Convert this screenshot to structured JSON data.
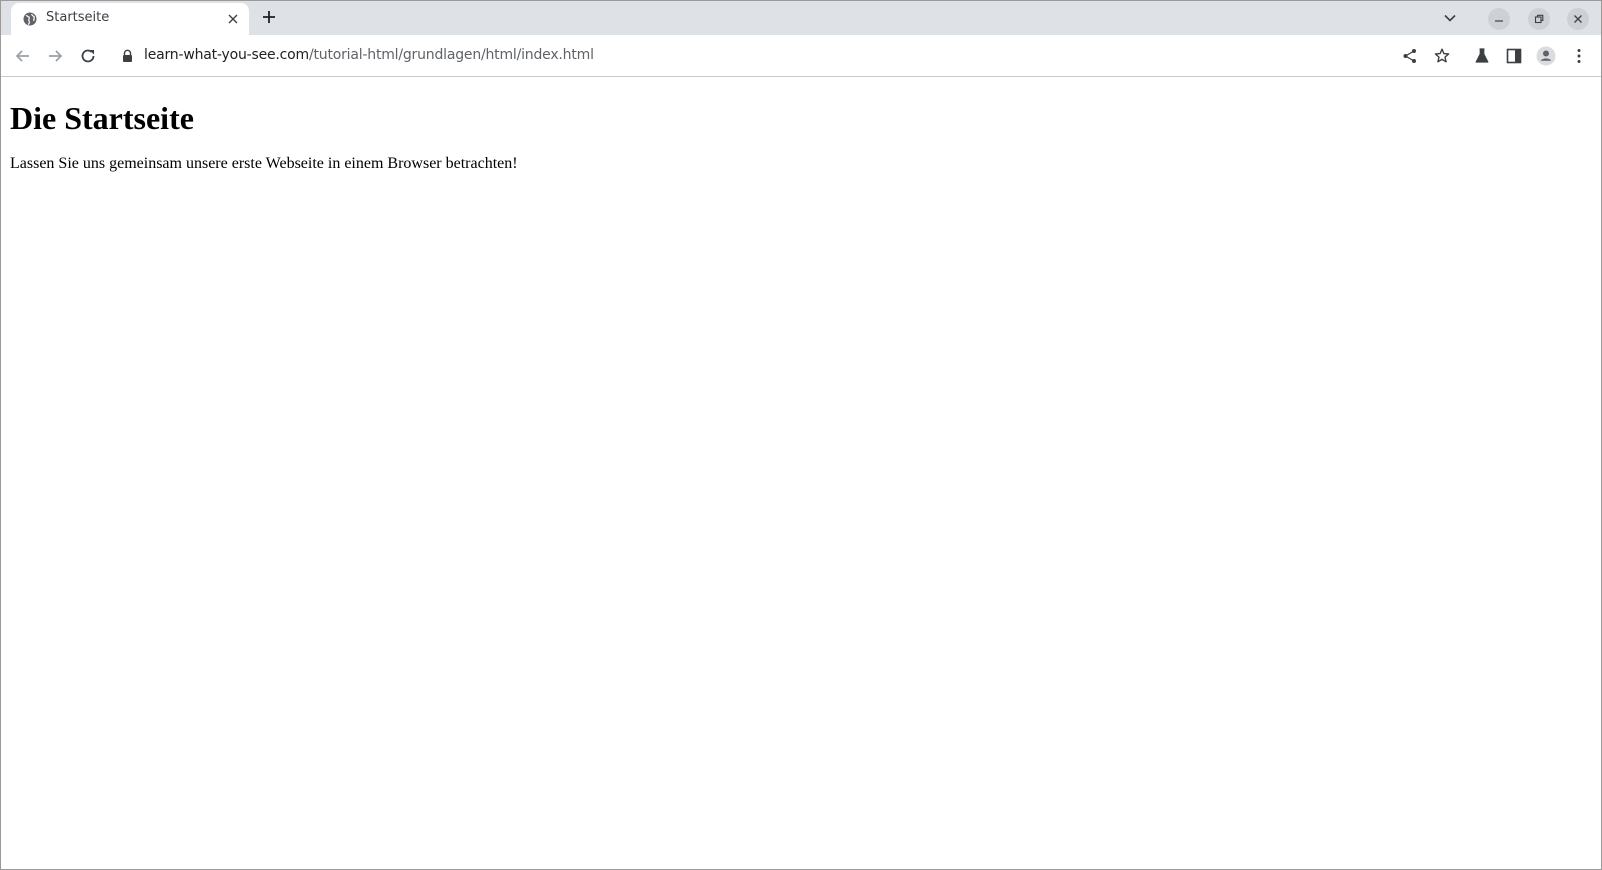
{
  "browser": {
    "tab": {
      "title": "Startseite",
      "favicon": "globe-icon"
    },
    "address_bar": {
      "host": "learn-what-you-see.com",
      "path": "/tutorial-html/grundlagen/html/index.html"
    },
    "icons": {
      "close_tab": "close-icon",
      "new_tab": "plus-icon",
      "tab_search": "chevron-down-icon",
      "minimize": "minimize-icon",
      "restore": "restore-icon",
      "close_window": "close-icon",
      "back": "arrow-left-icon",
      "forward": "arrow-right-icon",
      "reload": "reload-icon",
      "lock": "lock-icon",
      "share": "share-icon",
      "bookmark": "star-icon",
      "labs": "flask-icon",
      "side_panel": "side-panel-icon",
      "profile": "profile-icon",
      "menu": "kebab-menu-icon"
    },
    "colors": {
      "tabstrip": "#dee1e6",
      "icon": "#5f6368",
      "text": "#202124"
    }
  },
  "page": {
    "heading": "Die Startseite",
    "paragraph": "Lassen Sie uns gemeinsam unsere erste Webseite in einem Browser betrachten!"
  }
}
